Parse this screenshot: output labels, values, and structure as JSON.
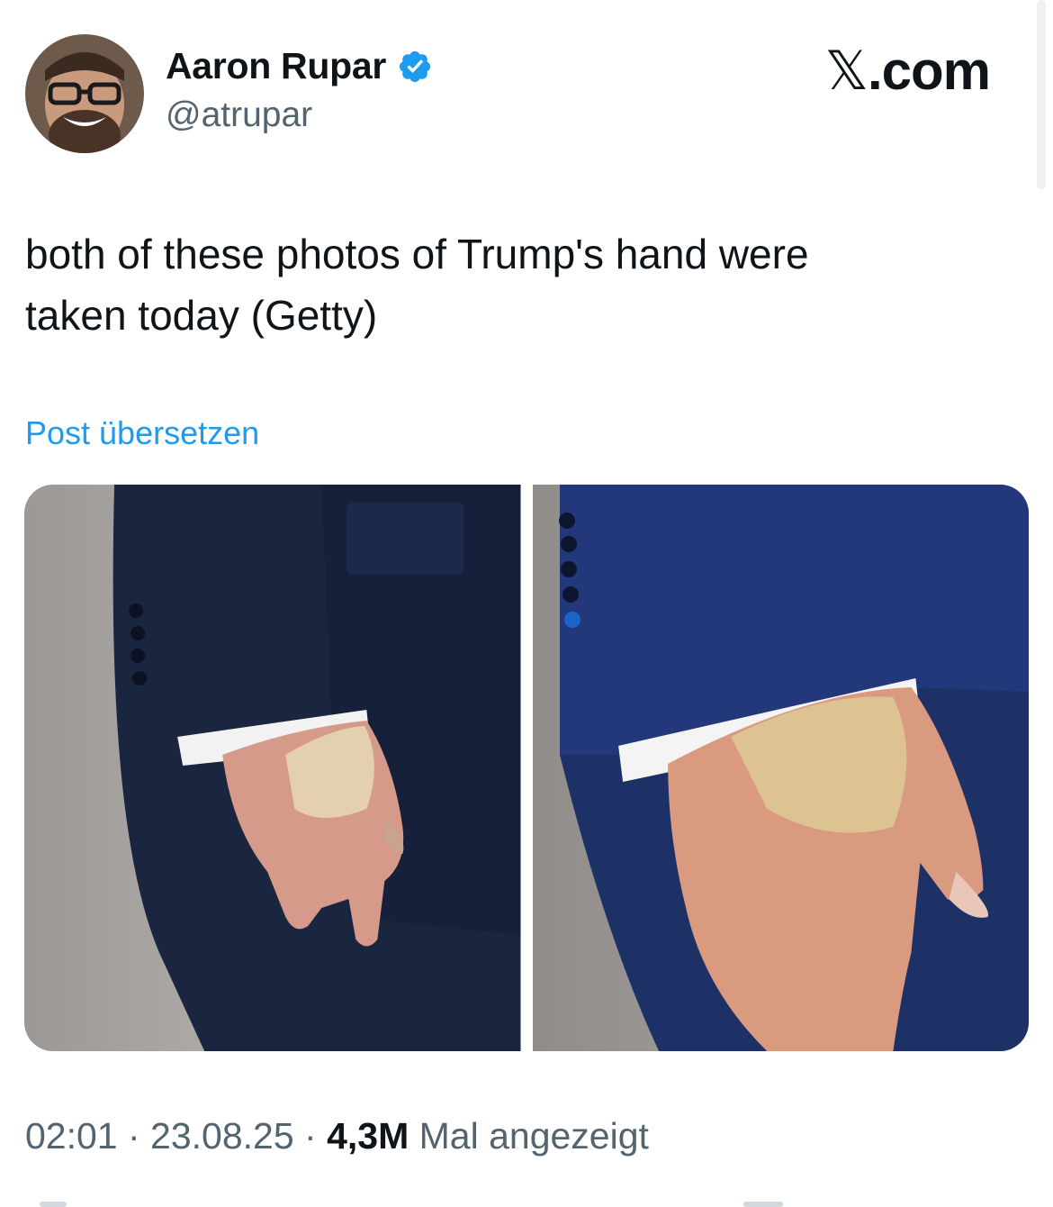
{
  "author": {
    "name": "Aaron Rupar",
    "handle": "@atrupar",
    "verified": true,
    "avatar_icon": "profile-photo"
  },
  "brand": {
    "x_mark": "𝕏",
    "suffix": ".com"
  },
  "tweet": {
    "text_line1": "both of these photos of Trump's hand were",
    "text_line2": "taken today (Getty)",
    "translate_link": "Post übersetzen"
  },
  "meta": {
    "time": "02:01",
    "sep1": " · ",
    "date": "23.08.25",
    "sep2": " · ",
    "views": "4,3M",
    "views_label": " Mal angezeigt"
  },
  "colors": {
    "link": "#1d9bf0",
    "secondary_text": "#536471",
    "verified_badge": "#1d9bf0",
    "suit_navy": "#1c2a4a"
  }
}
